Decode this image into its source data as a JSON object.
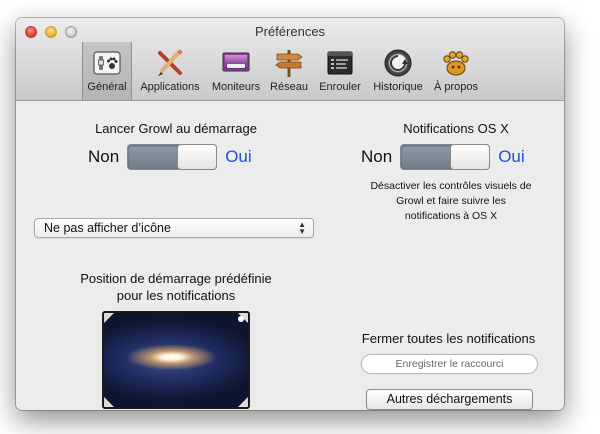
{
  "window": {
    "title": "Préférences"
  },
  "toolbar": {
    "items": [
      {
        "label": "Général",
        "icon": "general-switch-icon",
        "active": true
      },
      {
        "label": "Applications",
        "icon": "applications-tools-icon",
        "active": false
      },
      {
        "label": "Moniteurs",
        "icon": "display-monitor-icon",
        "active": false
      },
      {
        "label": "Réseau",
        "icon": "signpost-icon",
        "active": false
      },
      {
        "label": "Enrouler",
        "icon": "rollup-window-icon",
        "active": false
      },
      {
        "label": "Historique",
        "icon": "history-knob-icon",
        "active": false
      },
      {
        "label": "À propos",
        "icon": "growl-paw-icon",
        "active": false
      }
    ]
  },
  "launch": {
    "title": "Lancer Growl au démarrage",
    "off_label": "Non",
    "on_label": "Oui",
    "state": "on"
  },
  "osx": {
    "title": "Notifications OS X",
    "off_label": "Non",
    "on_label": "Oui",
    "state": "on",
    "desc_line1": "Désactiver les contrôles visuels de",
    "desc_line2": "Growl et faire suivre les",
    "desc_line3": "notifications à OS X"
  },
  "icon_menu": {
    "selected": "Ne pas afficher d’icône"
  },
  "position": {
    "title_line1": "Position de démarrage prédéfinie",
    "title_line2": "pour les notifications",
    "selected_corner": "top-right"
  },
  "close_all": {
    "title": "Fermer toutes les notifications",
    "shortcut_placeholder": "Enregistrer le raccourci"
  },
  "buttons": {
    "other_downloads": "Autres déchargements"
  },
  "colors": {
    "link_blue": "#1b4fe0",
    "window_bg": "#ececec"
  }
}
